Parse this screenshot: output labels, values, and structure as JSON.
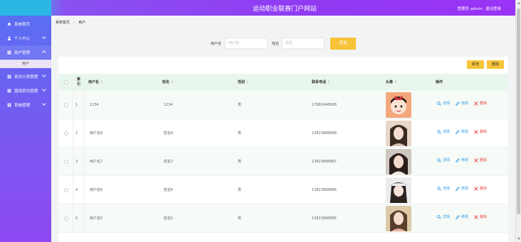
{
  "header": {
    "title": "运动职业联赛门户网站",
    "user_info": "管理员 admin",
    "logout": "退出登录"
  },
  "sidebar": {
    "items": [
      {
        "label": "系统首页",
        "icon": "home-icon"
      },
      {
        "label": "个人中心",
        "icon": "user-icon"
      },
      {
        "label": "用户管理",
        "icon": "users-icon"
      },
      {
        "label": "资讯分类管理",
        "icon": "grid-icon"
      },
      {
        "label": "篮球资讯管理",
        "icon": "grid-icon"
      },
      {
        "label": "系统管理",
        "icon": "grid-icon"
      }
    ],
    "sub_item": "用户"
  },
  "breadcrumb": {
    "home": "系统首页",
    "separator": "»",
    "current": "用户"
  },
  "search": {
    "username_label": "用户名",
    "username_placeholder": "用户名",
    "name_label": "姓名",
    "name_placeholder": "姓名",
    "button": "查询"
  },
  "toolbar": {
    "add": "新增",
    "delete": "删除"
  },
  "table": {
    "headers": {
      "index_line1": "索",
      "index_line2": "引",
      "username": "用户名",
      "name": "姓名",
      "gender": "性别",
      "phone": "联系电话",
      "avatar": "头像",
      "actions": "操作"
    },
    "actions": {
      "view": "详情",
      "edit": "修改",
      "delete": "删除"
    },
    "rows": [
      {
        "index": "1",
        "username": "1234",
        "name": "1234",
        "gender": "男",
        "phone": "17680448908"
      },
      {
        "index": "2",
        "username": "用户名8",
        "name": "姓名8",
        "gender": "男",
        "phone": "13823888888"
      },
      {
        "index": "3",
        "username": "用户名7",
        "name": "姓名7",
        "gender": "男",
        "phone": "13823888887"
      },
      {
        "index": "4",
        "username": "用户名6",
        "name": "姓名6",
        "gender": "男",
        "phone": "13823888886"
      },
      {
        "index": "5",
        "username": "用户名5",
        "name": "姓名5",
        "gender": "男",
        "phone": "13823888885"
      }
    ]
  },
  "colors": {
    "accent": "#f7c338",
    "header_gradient_end": "#9933f5",
    "table_header_bg": "#e9f6ed"
  }
}
